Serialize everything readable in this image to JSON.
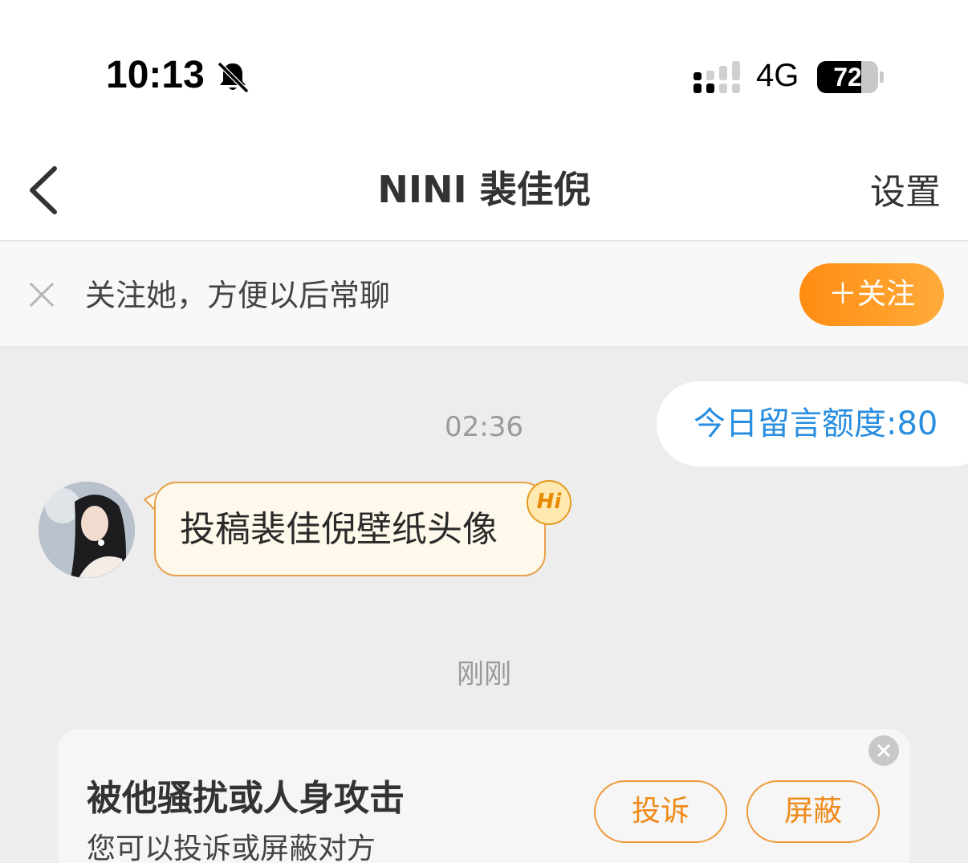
{
  "status_bar": {
    "time": "10:13",
    "network": "4G",
    "battery_level": "72",
    "battery_fraction": 0.72,
    "icons": [
      "bell-muted-icon",
      "signal-icon"
    ]
  },
  "nav": {
    "title": "NINI 裴佳倪",
    "settings_label": "设置",
    "back_icon": "chevron-left-icon"
  },
  "follow_bar": {
    "hint": "关注她，方便以后常聊",
    "follow_label": "＋关注",
    "close_icon": "close-icon",
    "accent": "#ff8c12"
  },
  "chat": {
    "quota_text": "今日留言额度:80",
    "timestamp_1": "02:36",
    "message_text": "投稿裴佳倪壁纸头像",
    "hi_badge": "Hi",
    "timestamp_2": "刚刚",
    "link_color": "#2a8ee0"
  },
  "report_card": {
    "title": "被他骚扰或人身攻击",
    "subtitle": "您可以投诉或屏蔽对方",
    "complain_label": "投诉",
    "block_label": "屏蔽"
  }
}
